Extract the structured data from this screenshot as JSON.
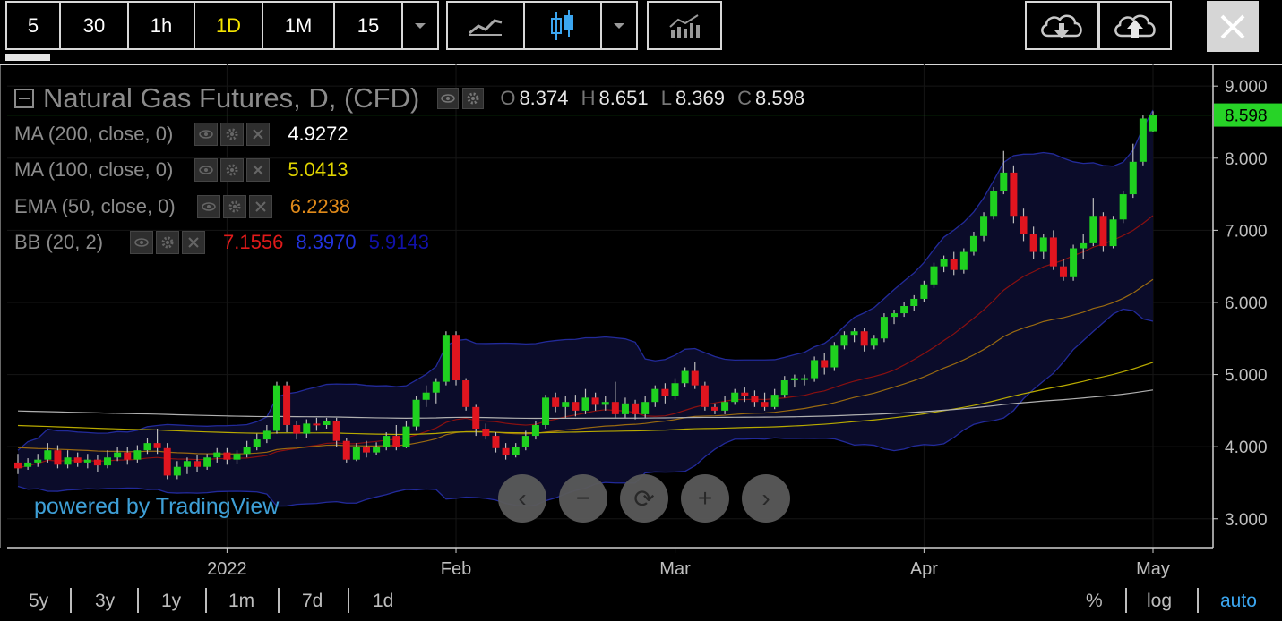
{
  "toolbar": {
    "intervals": [
      "5",
      "30",
      "1h",
      "1D",
      "1M",
      "15"
    ],
    "active_interval": "1D",
    "icons": [
      "interval-dropdown-icon",
      "line-chart-icon",
      "candlestick-icon",
      "chart-type-dropdown-icon",
      "indicators-icon",
      "cloud-download-icon",
      "cloud-upload-icon",
      "close-icon"
    ]
  },
  "legend": {
    "title": "Natural Gas Futures, D, (CFD)",
    "ohlc": {
      "o_label": "O",
      "o": "8.374",
      "h_label": "H",
      "h": "8.651",
      "l_label": "L",
      "l": "8.369",
      "c_label": "C",
      "c": "8.598"
    },
    "indicators": [
      {
        "name": "MA (200, close, 0)",
        "values": [
          "4.9272"
        ],
        "colors": [
          "#ffffff"
        ]
      },
      {
        "name": "MA (100, close, 0)",
        "values": [
          "5.0413"
        ],
        "colors": [
          "#e0d400"
        ]
      },
      {
        "name": "EMA (50, close, 0)",
        "values": [
          "6.2238"
        ],
        "colors": [
          "#e08a1a"
        ]
      },
      {
        "name": "BB (20, 2)",
        "values": [
          "7.1556",
          "8.3970",
          "5.9143"
        ],
        "colors": [
          "#e01a1a",
          "#2233dd",
          "#1111aa"
        ]
      }
    ]
  },
  "price_axis": {
    "ticks": [
      "9.000",
      "8.000",
      "7.000",
      "6.000",
      "5.000",
      "4.000",
      "3.000"
    ],
    "current_price": "8.598",
    "current_color": "#27d327"
  },
  "time_axis": {
    "labels": [
      "2022",
      "Feb",
      "Mar",
      "Apr",
      "May"
    ]
  },
  "branding": "powered by TradingView",
  "nav_buttons": [
    "‹",
    "−",
    "⟳",
    "+",
    "›"
  ],
  "ranges": [
    "5y",
    "3y",
    "1y",
    "1m",
    "7d",
    "1d"
  ],
  "scale_options": [
    "%",
    "log",
    "auto"
  ],
  "active_scale": "auto",
  "colors": {
    "up": "#1fd11f",
    "down": "#e0151f",
    "bb_fill": "#0b0c2a",
    "grid": "#161616"
  },
  "chart_data": {
    "type": "candlestick",
    "title": "Natural Gas Futures, D, (CFD)",
    "ylim": [
      2.6,
      9.3
    ],
    "xlabels": [
      "2022",
      "Feb",
      "Mar",
      "Apr",
      "May"
    ],
    "candles": [
      [
        3.78,
        3.7,
        3.9,
        3.62
      ],
      [
        3.72,
        3.78,
        3.84,
        3.68
      ],
      [
        3.78,
        3.82,
        3.9,
        3.72
      ],
      [
        3.82,
        3.95,
        4.05,
        3.78
      ],
      [
        3.95,
        3.75,
        4.02,
        3.7
      ],
      [
        3.75,
        3.85,
        3.95,
        3.7
      ],
      [
        3.85,
        3.78,
        3.92,
        3.72
      ],
      [
        3.78,
        3.82,
        3.9,
        3.7
      ],
      [
        3.82,
        3.74,
        3.88,
        3.65
      ],
      [
        3.74,
        3.85,
        3.95,
        3.7
      ],
      [
        3.85,
        3.92,
        4.0,
        3.8
      ],
      [
        3.92,
        3.82,
        4.0,
        3.75
      ],
      [
        3.82,
        3.95,
        4.02,
        3.78
      ],
      [
        3.95,
        4.05,
        4.12,
        3.9
      ],
      [
        4.05,
        3.98,
        4.25,
        3.9
      ],
      [
        3.98,
        3.6,
        4.05,
        3.55
      ],
      [
        3.6,
        3.72,
        3.8,
        3.55
      ],
      [
        3.72,
        3.8,
        3.85,
        3.62
      ],
      [
        3.8,
        3.72,
        3.88,
        3.65
      ],
      [
        3.72,
        3.85,
        3.9,
        3.68
      ],
      [
        3.85,
        3.92,
        3.98,
        3.78
      ],
      [
        3.92,
        3.82,
        3.98,
        3.75
      ],
      [
        3.82,
        3.9,
        3.95,
        3.76
      ],
      [
        3.9,
        4.0,
        4.08,
        3.85
      ],
      [
        4.0,
        4.1,
        4.18,
        3.95
      ],
      [
        4.1,
        4.22,
        4.3,
        4.05
      ],
      [
        4.22,
        4.85,
        4.9,
        4.18
      ],
      [
        4.85,
        4.3,
        4.9,
        4.2
      ],
      [
        4.3,
        4.18,
        4.35,
        4.1
      ],
      [
        4.18,
        4.32,
        4.38,
        4.12
      ],
      [
        4.32,
        4.3,
        4.4,
        4.22
      ],
      [
        4.3,
        4.35,
        4.4,
        4.25
      ],
      [
        4.35,
        4.08,
        4.4,
        4.0
      ],
      [
        4.08,
        3.82,
        4.12,
        3.78
      ],
      [
        3.82,
        4.0,
        4.05,
        3.8
      ],
      [
        4.0,
        3.92,
        4.08,
        3.85
      ],
      [
        3.92,
        4.0,
        4.06,
        3.88
      ],
      [
        4.0,
        4.15,
        4.2,
        3.95
      ],
      [
        4.15,
        4.0,
        4.3,
        3.95
      ],
      [
        4.0,
        4.28,
        4.35,
        3.98
      ],
      [
        4.28,
        4.65,
        4.7,
        4.22
      ],
      [
        4.65,
        4.75,
        4.85,
        4.55
      ],
      [
        4.75,
        4.9,
        4.95,
        4.6
      ],
      [
        4.9,
        5.55,
        5.6,
        4.85
      ],
      [
        5.55,
        4.92,
        5.6,
        4.85
      ],
      [
        4.92,
        4.55,
        4.95,
        4.5
      ],
      [
        4.55,
        4.25,
        4.58,
        4.15
      ],
      [
        4.25,
        4.15,
        4.32,
        4.1
      ],
      [
        4.15,
        3.98,
        4.2,
        3.92
      ],
      [
        3.98,
        3.88,
        4.05,
        3.82
      ],
      [
        3.88,
        4.0,
        4.05,
        3.85
      ],
      [
        4.0,
        4.15,
        4.22,
        3.95
      ],
      [
        4.15,
        4.3,
        4.35,
        4.1
      ],
      [
        4.3,
        4.68,
        4.72,
        4.25
      ],
      [
        4.68,
        4.55,
        4.75,
        4.48
      ],
      [
        4.55,
        4.62,
        4.7,
        4.4
      ],
      [
        4.62,
        4.5,
        4.72,
        4.42
      ],
      [
        4.5,
        4.68,
        4.8,
        4.45
      ],
      [
        4.68,
        4.58,
        4.75,
        4.5
      ],
      [
        4.58,
        4.62,
        4.7,
        4.5
      ],
      [
        4.62,
        4.45,
        4.9,
        4.4
      ],
      [
        4.45,
        4.6,
        4.68,
        4.4
      ],
      [
        4.6,
        4.45,
        4.65,
        4.38
      ],
      [
        4.45,
        4.62,
        4.7,
        4.4
      ],
      [
        4.62,
        4.8,
        4.85,
        4.55
      ],
      [
        4.8,
        4.7,
        4.88,
        4.6
      ],
      [
        4.7,
        4.88,
        4.95,
        4.65
      ],
      [
        4.88,
        5.05,
        5.1,
        4.82
      ],
      [
        5.05,
        4.85,
        5.18,
        4.8
      ],
      [
        4.85,
        4.55,
        4.9,
        4.5
      ],
      [
        4.55,
        4.5,
        4.6,
        4.45
      ],
      [
        4.5,
        4.62,
        4.7,
        4.45
      ],
      [
        4.62,
        4.75,
        4.8,
        4.58
      ],
      [
        4.75,
        4.7,
        4.82,
        4.62
      ],
      [
        4.7,
        4.62,
        4.78,
        4.55
      ],
      [
        4.62,
        4.55,
        4.75,
        4.5
      ],
      [
        4.55,
        4.72,
        4.8,
        4.52
      ],
      [
        4.72,
        4.92,
        4.98,
        4.68
      ],
      [
        4.92,
        4.95,
        5.0,
        4.82
      ],
      [
        4.95,
        4.95,
        5.0,
        4.85
      ],
      [
        4.95,
        5.2,
        5.25,
        4.9
      ],
      [
        5.2,
        5.1,
        5.3,
        5.0
      ],
      [
        5.1,
        5.4,
        5.45,
        5.05
      ],
      [
        5.4,
        5.55,
        5.6,
        5.35
      ],
      [
        5.55,
        5.6,
        5.65,
        5.45
      ],
      [
        5.6,
        5.4,
        5.65,
        5.32
      ],
      [
        5.4,
        5.5,
        5.55,
        5.35
      ],
      [
        5.5,
        5.8,
        5.85,
        5.45
      ],
      [
        5.8,
        5.85,
        5.9,
        5.7
      ],
      [
        5.85,
        5.95,
        6.0,
        5.8
      ],
      [
        5.95,
        6.05,
        6.1,
        5.88
      ],
      [
        6.05,
        6.25,
        6.3,
        6.0
      ],
      [
        6.25,
        6.5,
        6.55,
        6.2
      ],
      [
        6.5,
        6.6,
        6.65,
        6.42
      ],
      [
        6.6,
        6.45,
        6.7,
        6.38
      ],
      [
        6.45,
        6.7,
        6.75,
        6.4
      ],
      [
        6.7,
        6.92,
        6.98,
        6.65
      ],
      [
        6.92,
        7.2,
        7.25,
        6.85
      ],
      [
        7.2,
        7.55,
        7.6,
        7.15
      ],
      [
        7.55,
        7.8,
        8.1,
        7.5
      ],
      [
        7.8,
        7.2,
        7.9,
        7.1
      ],
      [
        7.2,
        6.95,
        7.3,
        6.85
      ],
      [
        6.95,
        6.7,
        7.05,
        6.6
      ],
      [
        6.7,
        6.9,
        6.95,
        6.6
      ],
      [
        6.9,
        6.5,
        7.0,
        6.45
      ],
      [
        6.5,
        6.35,
        6.6,
        6.3
      ],
      [
        6.35,
        6.75,
        6.8,
        6.3
      ],
      [
        6.75,
        6.82,
        6.95,
        6.6
      ],
      [
        6.82,
        7.2,
        7.45,
        6.78
      ],
      [
        7.2,
        6.78,
        7.25,
        6.7
      ],
      [
        6.78,
        7.15,
        7.2,
        6.75
      ],
      [
        7.15,
        7.5,
        7.55,
        7.1
      ],
      [
        7.5,
        7.95,
        8.2,
        7.45
      ],
      [
        7.95,
        8.55,
        8.6,
        7.9
      ],
      [
        8.374,
        8.598,
        8.651,
        8.369
      ]
    ],
    "series": [
      {
        "name": "MA (200, close, 0)",
        "color": "#c8c8c8"
      },
      {
        "name": "MA (100, close, 0)",
        "color": "#c8bd00"
      },
      {
        "name": "EMA (50, close, 0)",
        "color": "#b07000"
      },
      {
        "name": "BB (20, 2)",
        "color": "#2233dd"
      }
    ]
  }
}
